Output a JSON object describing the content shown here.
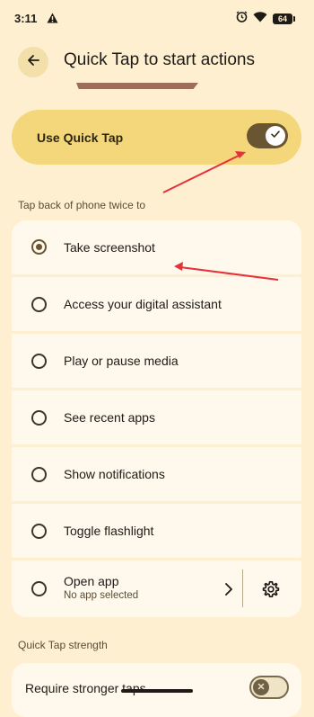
{
  "status_bar": {
    "time": "3:11",
    "battery": "64",
    "icons": [
      "alert-triangle-icon",
      "alarm-icon",
      "wifi-icon",
      "battery-icon"
    ]
  },
  "header": {
    "title": "Quick Tap to start actions",
    "back_icon": "arrow-left-icon"
  },
  "master_switch": {
    "label": "Use Quick Tap",
    "on": true
  },
  "actions_section": {
    "header": "Tap back of phone twice to",
    "options": [
      {
        "label": "Take screenshot",
        "selected": true
      },
      {
        "label": "Access your digital assistant",
        "selected": false
      },
      {
        "label": "Play or pause media",
        "selected": false
      },
      {
        "label": "See recent apps",
        "selected": false
      },
      {
        "label": "Show notifications",
        "selected": false
      },
      {
        "label": "Toggle flashlight",
        "selected": false
      }
    ],
    "open_app": {
      "label": "Open app",
      "sublabel": "No app selected",
      "selected": false
    }
  },
  "strength_section": {
    "header": "Quick Tap strength",
    "require_stronger_taps": {
      "label": "Require stronger taps",
      "on": false
    }
  },
  "colors": {
    "background": "#fdefcf",
    "master_card": "#f3d77a",
    "toggle_track_on": "#6a5532",
    "option_card": "#fef8ed",
    "annotation_arrow": "#e8303a"
  }
}
